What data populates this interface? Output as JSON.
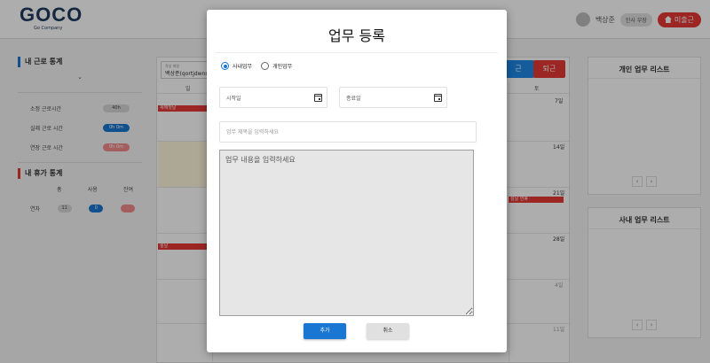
{
  "header": {
    "logo_text": "GOCO",
    "logo_sub": "Go Company",
    "user_name": "백상준",
    "user_dept": "인사 부장",
    "attend_button": "미출근"
  },
  "sidebar": {
    "work_stats_title": "내 근로 통계",
    "work_stats_arrow": "⌄",
    "rows": [
      {
        "label": "소정 근로시간",
        "value": "40h"
      },
      {
        "label": "실제 근로 시간",
        "value": "0h 0m"
      },
      {
        "label": "연장 근로 시간",
        "value": "0h 0m"
      }
    ],
    "vacation_title": "내 휴가 통계",
    "vacation_headers": [
      "총",
      "사용",
      "잔여"
    ],
    "vacation_row": {
      "label": "연차",
      "total": "11",
      "used": "0",
      "remain": ""
    }
  },
  "calendar": {
    "search_label": "작성 회원",
    "search_value": "백상준(qortjdwns",
    "day_headers": [
      "일",
      "토"
    ],
    "days": [
      "7일",
      "14일",
      "21일",
      "28일",
      "4일",
      "11일"
    ],
    "events": [
      "새해첫날",
      "설날 연휴",
      "설날"
    ],
    "btn_go": "근",
    "btn_leave": "퇴근"
  },
  "right_cards": {
    "personal_title": "개인 업무 리스트",
    "company_title": "사내 업무 리스트",
    "prev": "‹",
    "next": "›"
  },
  "modal": {
    "title": "업무 등록",
    "radio_company": "사내업무",
    "radio_personal": "개인업무",
    "selected_type": "사내업무",
    "start_date_placeholder": "시작일",
    "end_date_placeholder": "종료일",
    "title_placeholder": "업무 제목을 입력하세요",
    "content_placeholder": "업무 내용을 입력하세요",
    "add_button": "추가",
    "cancel_button": "취소"
  }
}
